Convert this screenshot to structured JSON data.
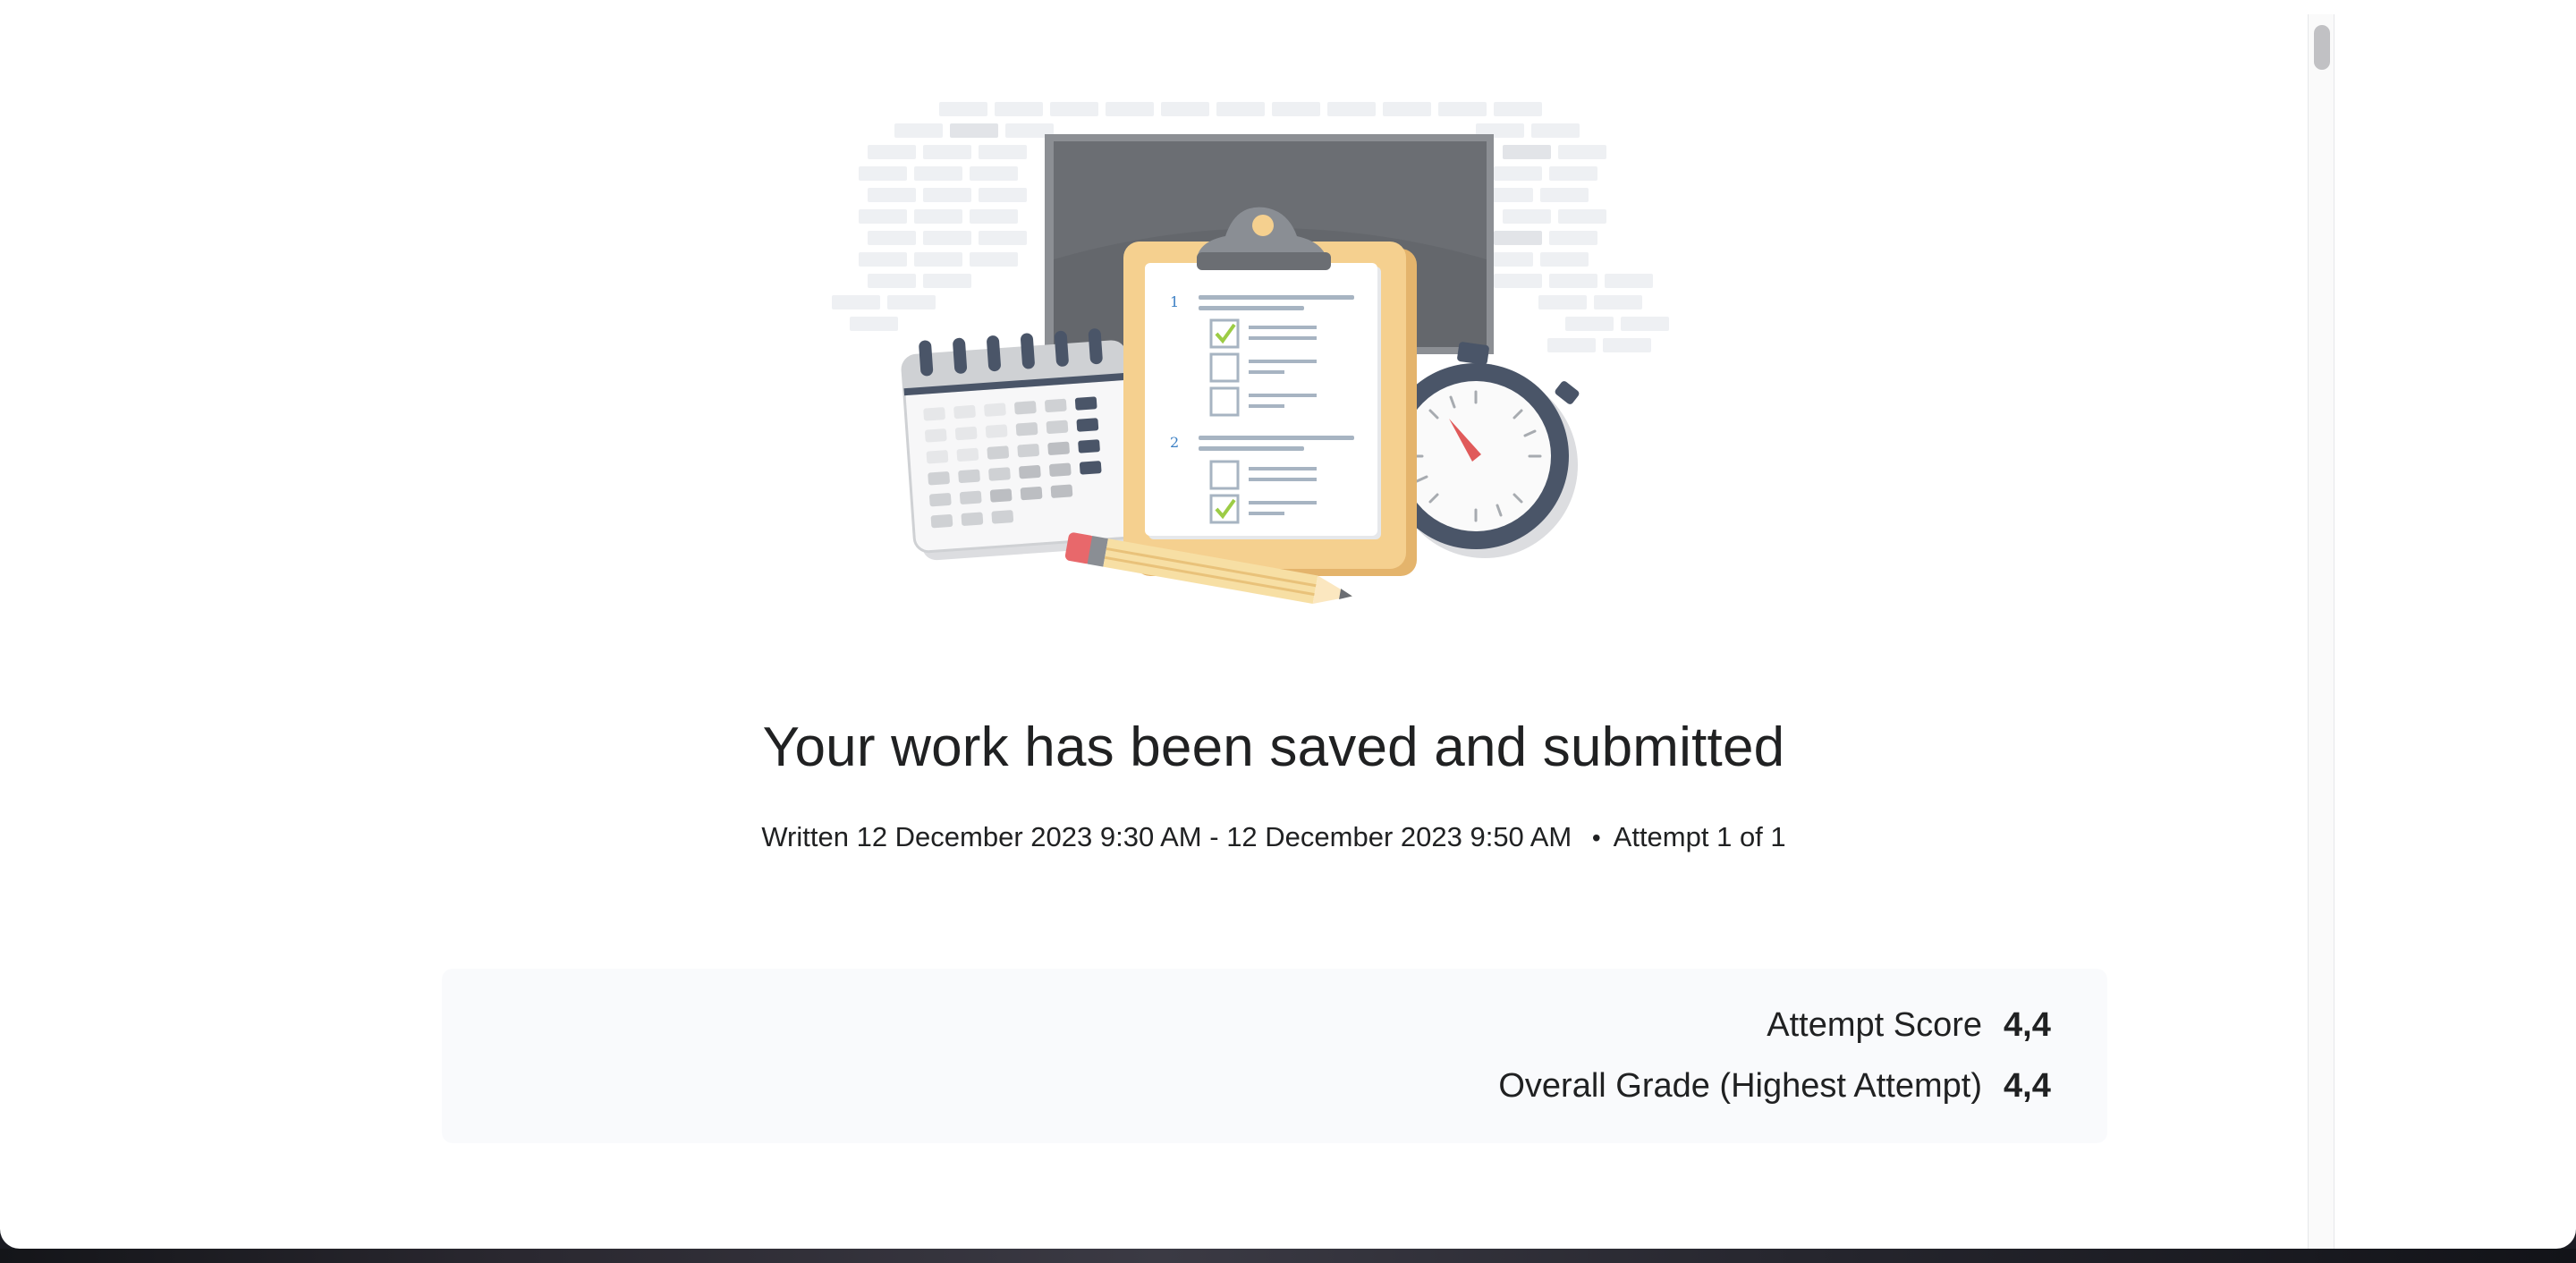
{
  "confirmation": {
    "title": "Your work has been saved and submitted",
    "written_label": "Written",
    "start_time": "12 December 2023 9:30 AM",
    "separator": "-",
    "end_time": "12 December 2023 9:50 AM",
    "bullet": "•",
    "attempt": "Attempt 1 of 1"
  },
  "scores": {
    "attempt_score_label": "Attempt Score",
    "attempt_score_value": "4,4",
    "overall_grade_label": "Overall Grade (Highest Attempt)",
    "overall_grade_value": "4,4"
  },
  "illustration": {
    "items": [
      "chalkboard-icon",
      "clipboard-icon",
      "calendar-icon",
      "stopwatch-icon",
      "pencil-icon"
    ],
    "question_numbers": [
      "1",
      "2"
    ],
    "colors": {
      "brick": "#eceef1",
      "chalkboard": "#6b6e73",
      "clipboard": "#f5d08f",
      "stopwatch": "#4a5568",
      "check": "#9ccc45",
      "needle": "#e05a5a",
      "pencil": "#f7dfa4",
      "eraser": "#e8686b"
    }
  }
}
